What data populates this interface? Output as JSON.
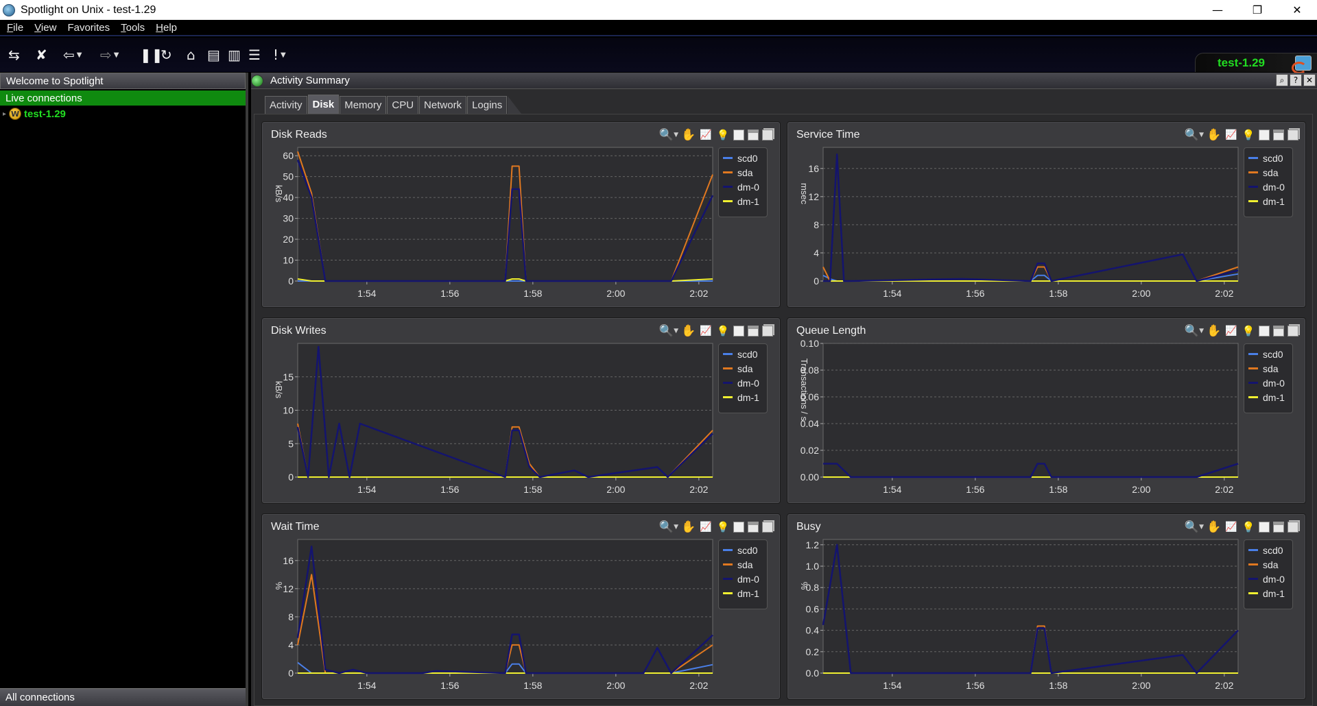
{
  "window": {
    "title": "Spotlight on Unix - test-1.29",
    "minimize": "—",
    "restore": "❐",
    "close": "✕"
  },
  "menu": [
    {
      "key": "F",
      "rest": "ile"
    },
    {
      "key": "V",
      "rest": "iew"
    },
    {
      "key": "",
      "rest": "Favorites"
    },
    {
      "key": "T",
      "rest": "ools"
    },
    {
      "key": "H",
      "rest": "elp"
    }
  ],
  "hostbadge": {
    "name": "test-1.29"
  },
  "leftpanel": {
    "header": "Welcome to Spotlight",
    "live": "Live connections",
    "node": "test-1.29",
    "footer": "All connections"
  },
  "mainpanel": {
    "title": "Activity Summary",
    "tabs": [
      "Activity",
      "Disk",
      "Memory",
      "CPU",
      "Network",
      "Logins"
    ],
    "active_tab": 1
  },
  "series_colors": {
    "scd0": "#4a7fe8",
    "sda": "#e07820",
    "dm-0": "#14146e",
    "dm-1": "#f0f030"
  },
  "chart_data": [
    {
      "type": "line",
      "title": "Disk Reads",
      "ylabel": "kB/s",
      "x": [
        "1:52:20",
        "1:52:40",
        "1:53:00",
        "1:57:20",
        "1:57:30",
        "1:57:40",
        "1:57:50",
        "1:58:00",
        "2:01:20",
        "2:02:20"
      ],
      "xticks": [
        "1:54",
        "1:56",
        "1:58",
        "2:00",
        "2:02"
      ],
      "yticks": [
        0,
        10,
        20,
        30,
        40,
        50,
        60
      ],
      "ylim": [
        0,
        64
      ],
      "series": [
        {
          "name": "scd0",
          "values": [
            0,
            0,
            0,
            0,
            0,
            0,
            0,
            0,
            0,
            0
          ]
        },
        {
          "name": "sda",
          "values": [
            62,
            42,
            0,
            0,
            55,
            55,
            0,
            0,
            0,
            51
          ]
        },
        {
          "name": "dm-0",
          "values": [
            58,
            40,
            0,
            0,
            44,
            44,
            0,
            0,
            0,
            41
          ]
        },
        {
          "name": "dm-1",
          "values": [
            1,
            0,
            0,
            0,
            1,
            1,
            0,
            0,
            0,
            1
          ]
        }
      ]
    },
    {
      "type": "line",
      "title": "Service Time",
      "ylabel": "msec",
      "x": [
        "1:52:20",
        "1:52:30",
        "1:52:40",
        "1:52:50",
        "1:53:00",
        "1:55:40",
        "1:57:20",
        "1:57:30",
        "1:57:40",
        "1:57:50",
        "2:01:00",
        "2:01:20",
        "2:02:20"
      ],
      "xticks": [
        "1:54",
        "1:56",
        "1:58",
        "2:00",
        "2:02"
      ],
      "yticks": [
        0,
        4,
        8,
        12,
        16
      ],
      "ylim": [
        0,
        19
      ],
      "series": [
        {
          "name": "scd0",
          "values": [
            0.8,
            0.3,
            0,
            0,
            0,
            0,
            0,
            0.8,
            0.8,
            0,
            0,
            0,
            1.0
          ]
        },
        {
          "name": "sda",
          "values": [
            2,
            0,
            0,
            0,
            0,
            0,
            0,
            2,
            2,
            0,
            0,
            0,
            2
          ]
        },
        {
          "name": "dm-0",
          "values": [
            0,
            0,
            18,
            0,
            0,
            0.3,
            0,
            2.5,
            2.5,
            0,
            3.8,
            0,
            1.5
          ]
        },
        {
          "name": "dm-1",
          "values": [
            0,
            0,
            0,
            0,
            0,
            0,
            0,
            0,
            0,
            0,
            0,
            0,
            0
          ]
        }
      ]
    },
    {
      "type": "line",
      "title": "Disk Writes",
      "ylabel": "kB/s",
      "x": [
        "1:52:20",
        "1:52:35",
        "1:52:50",
        "1:53:05",
        "1:53:20",
        "1:53:35",
        "1:53:50",
        "1:57:20",
        "1:57:30",
        "1:57:40",
        "1:57:55",
        "1:58:10",
        "1:59:00",
        "1:59:20",
        "2:01:00",
        "2:01:15",
        "2:02:20"
      ],
      "xticks": [
        "1:54",
        "1:56",
        "1:58",
        "2:00",
        "2:02"
      ],
      "yticks": [
        0,
        5,
        10,
        15
      ],
      "ylim": [
        0,
        20
      ],
      "series": [
        {
          "name": "scd0",
          "values": [
            0,
            0,
            0,
            0,
            0,
            0,
            0,
            0,
            0,
            0,
            0,
            0,
            0,
            0,
            0,
            0,
            0
          ]
        },
        {
          "name": "sda",
          "values": [
            8,
            0,
            0,
            0,
            0,
            0,
            0,
            0,
            7.5,
            7.5,
            2,
            0,
            0,
            0,
            0,
            0,
            7
          ]
        },
        {
          "name": "dm-0",
          "values": [
            7.5,
            0,
            19.5,
            0,
            8,
            0,
            8,
            0,
            7,
            7,
            1.5,
            0,
            1,
            0,
            1.5,
            0,
            6.5
          ]
        },
        {
          "name": "dm-1",
          "values": [
            0,
            0,
            0,
            0,
            0,
            0,
            0,
            0,
            0,
            0,
            0,
            0,
            0,
            0,
            0,
            0,
            0
          ]
        }
      ]
    },
    {
      "type": "line",
      "title": "Queue Length",
      "ylabel": "Transactions / s",
      "x": [
        "1:52:20",
        "1:52:40",
        "1:53:00",
        "1:57:20",
        "1:57:30",
        "1:57:40",
        "1:57:50",
        "2:01:20",
        "2:02:20"
      ],
      "xticks": [
        "1:54",
        "1:56",
        "1:58",
        "2:00",
        "2:02"
      ],
      "yticks": [
        "0.00",
        "0.02",
        "0.04",
        "0.06",
        "0.08",
        "0.10"
      ],
      "ylim": [
        0,
        0.1
      ],
      "series": [
        {
          "name": "scd0",
          "values": [
            0,
            0,
            0,
            0,
            0,
            0,
            0,
            0,
            0
          ]
        },
        {
          "name": "sda",
          "values": [
            0,
            0,
            0,
            0,
            0,
            0,
            0,
            0,
            0
          ]
        },
        {
          "name": "dm-0",
          "values": [
            0.01,
            0.01,
            0,
            0,
            0.01,
            0.01,
            0,
            0,
            0.01
          ]
        },
        {
          "name": "dm-1",
          "values": [
            0,
            0,
            0,
            0,
            0,
            0,
            0,
            0,
            0
          ]
        }
      ]
    },
    {
      "type": "line",
      "title": "Wait Time",
      "ylabel": "%",
      "x": [
        "1:52:20",
        "1:52:40",
        "1:53:00",
        "1:53:20",
        "1:53:40",
        "1:54:00",
        "1:55:20",
        "1:55:40",
        "1:57:20",
        "1:57:30",
        "1:57:40",
        "1:57:50",
        "2:00:40",
        "2:01:00",
        "2:01:20",
        "2:02:20"
      ],
      "xticks": [
        "1:54",
        "1:56",
        "1:58",
        "2:00",
        "2:02"
      ],
      "yticks": [
        0,
        4,
        8,
        12,
        16
      ],
      "ylim": [
        0,
        19
      ],
      "series": [
        {
          "name": "scd0",
          "values": [
            1.5,
            0,
            0,
            0,
            0,
            0,
            0,
            0,
            0,
            1.3,
            1.3,
            0,
            0,
            0,
            0,
            1.2
          ]
        },
        {
          "name": "sda",
          "values": [
            4,
            14,
            0,
            0,
            0,
            0,
            0,
            0,
            0,
            4,
            4,
            0,
            0,
            0,
            0,
            4
          ]
        },
        {
          "name": "dm-0",
          "values": [
            5,
            18,
            0.5,
            0,
            0.5,
            0,
            0,
            0.3,
            0,
            5.5,
            5.5,
            0,
            0,
            3.6,
            0,
            5.4
          ]
        },
        {
          "name": "dm-1",
          "values": [
            0,
            0,
            0,
            0,
            0,
            0,
            0,
            0,
            0,
            0,
            0,
            0,
            0,
            0,
            0,
            0
          ]
        }
      ]
    },
    {
      "type": "line",
      "title": "Busy",
      "ylabel": "%",
      "x": [
        "1:52:20",
        "1:52:40",
        "1:53:00",
        "1:53:20",
        "1:53:40",
        "1:54:00",
        "1:55:20",
        "1:55:40",
        "1:57:20",
        "1:57:30",
        "1:57:40",
        "1:57:50",
        "2:01:00",
        "2:01:20",
        "2:02:20"
      ],
      "xticks": [
        "1:54",
        "1:56",
        "1:58",
        "2:00",
        "2:02"
      ],
      "yticks": [
        "0.0",
        "0.2",
        "0.4",
        "0.6",
        "0.8",
        "1.0",
        "1.2"
      ],
      "ylim": [
        0,
        1.25
      ],
      "series": [
        {
          "name": "scd0",
          "values": [
            0,
            0,
            0,
            0,
            0,
            0,
            0,
            0,
            0,
            0,
            0,
            0,
            0,
            0,
            0
          ]
        },
        {
          "name": "sda",
          "values": [
            0,
            0,
            0,
            0,
            0,
            0,
            0,
            0,
            0,
            0.44,
            0.44,
            0,
            0,
            0,
            0.4
          ]
        },
        {
          "name": "dm-0",
          "values": [
            0.45,
            1.2,
            0,
            0,
            0,
            0,
            0,
            0,
            0,
            0.42,
            0.42,
            0,
            0.17,
            0,
            0.4
          ]
        },
        {
          "name": "dm-1",
          "values": [
            0,
            0,
            0,
            0,
            0,
            0,
            0,
            0,
            0,
            0,
            0,
            0,
            0,
            0,
            0
          ]
        }
      ]
    }
  ]
}
